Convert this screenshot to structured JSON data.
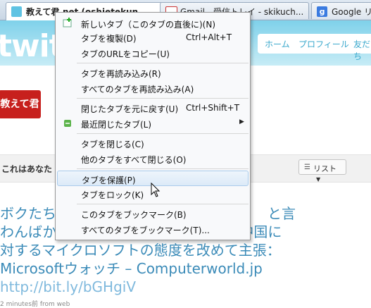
{
  "tabs": [
    {
      "title": "教えて君.net (oshietekun",
      "active": true,
      "icon": "twitter-icon"
    },
    {
      "title": "Gmail - 受信トレイ - skikuch...",
      "active": false,
      "icon": "gmail-icon"
    },
    {
      "title": "Google リー",
      "active": false,
      "icon": "google-icon"
    }
  ],
  "page": {
    "logo": "twitt",
    "nav": [
      "ホーム",
      "プロフィール",
      "友だち"
    ],
    "bar_text": "これはあなた",
    "list_button": "リスト",
    "tweet_text": "ボクたち　　　　　　　　　　　　　　　と言わんばか　　　　　　　　　　　　　中国に対するマイクロソフトの態度を改めて主張：Microsoftウォッチ – Computerworld.jp",
    "tweet_link": "http://bit.ly/bGHgiV",
    "tweet_meta": "2 minutes前 from web",
    "avatar_text": "教えて君"
  },
  "menu": {
    "items": [
      {
        "label": "新しいタブ（このタブの直後に)(N)",
        "shortcut": "",
        "icon": "new-tab-icon"
      },
      {
        "label": "タブを複製(D)",
        "shortcut": "Ctrl+Alt+T",
        "icon": ""
      },
      {
        "label": "タブのURLをコピー(U)",
        "shortcut": "",
        "icon": ""
      },
      {
        "label": "タブを再読み込み(R)",
        "shortcut": "",
        "icon": ""
      },
      {
        "label": "すべてのタブを再読み込み(A)",
        "shortcut": "",
        "icon": ""
      },
      {
        "label": "閉じたタブを元に戻す(U)",
        "shortcut": "Ctrl+Shift+T",
        "icon": ""
      },
      {
        "label": "最近閉じたタブ(L)",
        "shortcut": "",
        "icon": "recycle-icon",
        "submenu": true
      },
      {
        "label": "タブを閉じる(C)",
        "shortcut": "",
        "icon": ""
      },
      {
        "label": "他のタブをすべて閉じる(O)",
        "shortcut": "",
        "icon": ""
      },
      {
        "label": "タブを保護(P)",
        "shortcut": "",
        "icon": "",
        "hover": true
      },
      {
        "label": "タブをロック(K)",
        "shortcut": "",
        "icon": ""
      },
      {
        "label": "このタブをブックマーク(B)",
        "shortcut": "",
        "icon": ""
      },
      {
        "label": "すべてのタブをブックマーク(T)...",
        "shortcut": "",
        "icon": ""
      }
    ]
  },
  "colors": {
    "accent": "#3b8bb8",
    "header": "#7fd1ea",
    "hover": "#dceaf8"
  }
}
